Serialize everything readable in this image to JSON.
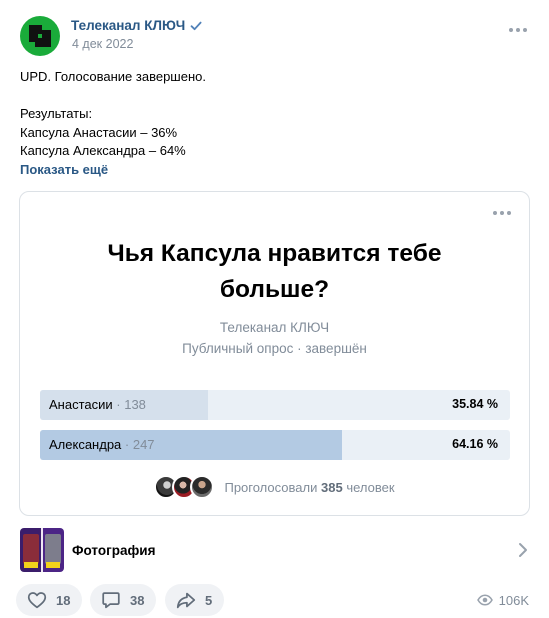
{
  "post": {
    "author": "Телеканал КЛЮЧ",
    "date": "4 дек 2022",
    "text_lines": [
      "UPD. Голосование завершено.",
      "",
      "Результаты:",
      "Капсула Анастасии – 36%",
      "Капсула Александра – 64%"
    ],
    "show_more": "Показать ещё"
  },
  "poll": {
    "title": "Чья Капсула нравится тебе больше?",
    "author": "Телеканал КЛЮЧ",
    "meta": "Публичный опрос · завершён",
    "options": [
      {
        "name": "Анастасии",
        "count": "· 138",
        "percent_label": "35.84 %",
        "percent": 35.84
      },
      {
        "name": "Александра",
        "count": "· 247",
        "percent_label": "64.16 %",
        "percent": 64.16
      }
    ],
    "voters_prefix": "Проголосовали",
    "voters_count": "385",
    "voters_suffix": "человек"
  },
  "attachment": {
    "label": "Фотография"
  },
  "actions": {
    "likes": "18",
    "comments": "38",
    "shares": "5",
    "views": "106K"
  },
  "colors": {
    "accent": "#2a5885",
    "avatar": "#1aab3a",
    "poll_bar": "#eaf0f6",
    "poll_fill": "#d5e0ec",
    "poll_fill_winner": "#b3cae3"
  },
  "icons": [
    "verified-icon",
    "more-icon",
    "chevron-right-icon",
    "heart-icon",
    "comment-icon",
    "share-icon",
    "eye-icon"
  ]
}
